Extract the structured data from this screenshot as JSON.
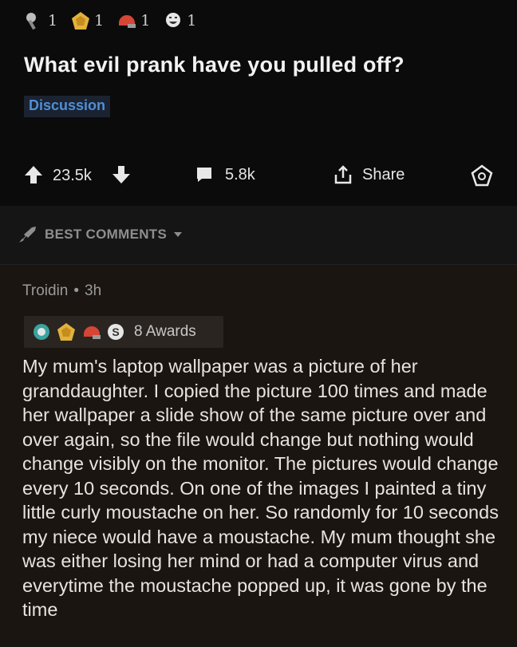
{
  "post": {
    "awards": [
      {
        "icon": "silver-award-icon",
        "count": "1"
      },
      {
        "icon": "gold-award-icon",
        "count": "1"
      },
      {
        "icon": "helmet-award-icon",
        "count": "1"
      },
      {
        "icon": "laughing-award-icon",
        "count": "1"
      }
    ],
    "title": "What evil prank have you pulled off?",
    "flair": "Discussion",
    "score": "23.5k",
    "comments_count": "5.8k",
    "share_label": "Share"
  },
  "sort": {
    "label": "BEST COMMENTS"
  },
  "comment": {
    "author": "Troidin",
    "separator": "•",
    "age": "3h",
    "awards_label": "8 Awards",
    "award_icons": [
      "globe-award-icon",
      "gold-award-icon",
      "helmet-award-icon",
      "silver-dollar-award-icon"
    ],
    "body": "My mum's laptop wallpaper was a picture of her granddaughter. I copied the picture 100 times and made her wallpaper a slide show of the same picture over and over again, so the file would change but nothing would change visibly on the monitor. The pictures would change every 10 seconds. On one of the images I painted a tiny little curly moustache on her. So randomly for 10 seconds my niece would have a moustache. My mum thought she was either losing her mind or had a computer virus and everytime the moustache popped up, it was gone by the time"
  },
  "colors": {
    "background": "#000000",
    "post_background": "#0b0b0c",
    "comment_background": "#1a1510",
    "flair_text": "#4f8fd8",
    "award_gold": "#e3b23c",
    "award_red": "#d64535"
  }
}
